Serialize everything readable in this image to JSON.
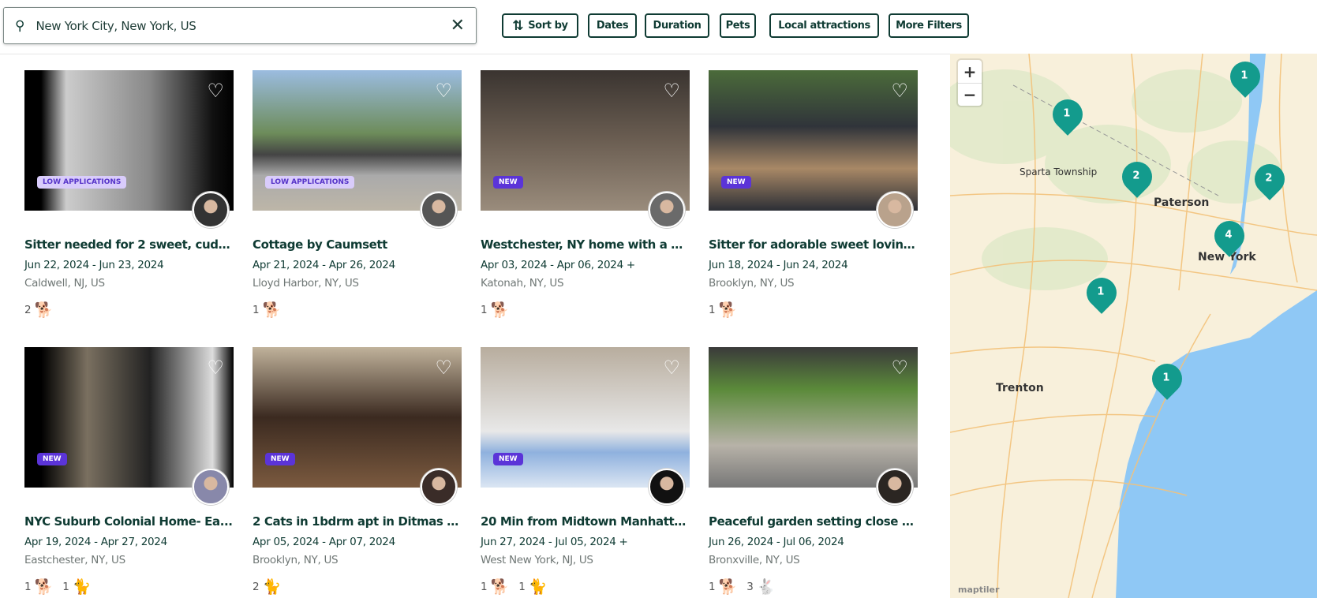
{
  "search": {
    "value": "New York City, New York, US",
    "icon": "search-icon",
    "clear_icon": "close-icon"
  },
  "filters": [
    {
      "label": "Sort by",
      "icon": "sort-arrows-icon"
    },
    {
      "label": "Dates"
    },
    {
      "label": "Duration"
    },
    {
      "label": "Pets"
    },
    {
      "label": "Local attractions"
    },
    {
      "label": "More Filters"
    }
  ],
  "listings": [
    {
      "title": "Sitter needed for 2 sweet, cuddl...",
      "dates": "Jun 22, 2024 - Jun 23, 2024",
      "location": "Caldwell, NJ, US",
      "badge": "LOW APPLICATIONS",
      "pets": [
        {
          "count": "2",
          "type": "dog"
        }
      ]
    },
    {
      "title": "Cottage by Caumsett",
      "dates": "Apr 21, 2024 - Apr 26, 2024",
      "location": "Lloyd Harbor, NY, US",
      "badge": "LOW APPLICATIONS",
      "pets": [
        {
          "count": "1",
          "type": "dog"
        }
      ]
    },
    {
      "title": "Westchester, NY home with a 1...",
      "dates": "Apr 03, 2024 - Apr 06, 2024 +",
      "location": "Katonah, NY, US",
      "badge": "NEW",
      "pets": [
        {
          "count": "1",
          "type": "dog"
        }
      ]
    },
    {
      "title": "Sitter for adorable sweet loving...",
      "dates": "Jun 18, 2024 - Jun 24, 2024",
      "location": "Brooklyn, NY, US",
      "badge": "NEW",
      "pets": [
        {
          "count": "1",
          "type": "dog"
        }
      ]
    },
    {
      "title": "NYC Suburb Colonial Home- Ea...",
      "dates": "Apr 19, 2024 - Apr 27, 2024",
      "location": "Eastchester, NY, US",
      "badge": "NEW",
      "pets": [
        {
          "count": "1",
          "type": "dog"
        },
        {
          "count": "1",
          "type": "cat"
        }
      ]
    },
    {
      "title": "2 Cats in 1bdrm apt in Ditmas P...",
      "dates": "Apr 05, 2024 - Apr 07, 2024",
      "location": "Brooklyn, NY, US",
      "badge": "NEW",
      "pets": [
        {
          "count": "2",
          "type": "cat"
        }
      ]
    },
    {
      "title": "20 Min from Midtown Manhatta...",
      "dates": "Jun 27, 2024 - Jul 05, 2024 +",
      "location": "West New York, NJ, US",
      "badge": "NEW",
      "pets": [
        {
          "count": "1",
          "type": "dog"
        },
        {
          "count": "1",
          "type": "cat"
        }
      ]
    },
    {
      "title": "Peaceful garden setting close t...",
      "dates": "Jun 26, 2024 - Jul 06, 2024",
      "location": "Bronxville, NY, US",
      "badge": "",
      "pets": [
        {
          "count": "1",
          "type": "dog"
        },
        {
          "count": "3",
          "type": "rabbit"
        }
      ]
    }
  ],
  "map": {
    "zoom_in": "+",
    "zoom_out": "−",
    "attribution": "maptiler",
    "cities": [
      "Sparta Township",
      "Paterson",
      "New York",
      "Trenton"
    ],
    "clusters": [
      "1",
      "1",
      "2",
      "2",
      "4",
      "1",
      "1"
    ],
    "marker_color": "#139b8d"
  },
  "colors": {
    "brand": "#0f3b33",
    "new_badge": "#5b34d8",
    "low_badge": "#d9ccfb"
  }
}
